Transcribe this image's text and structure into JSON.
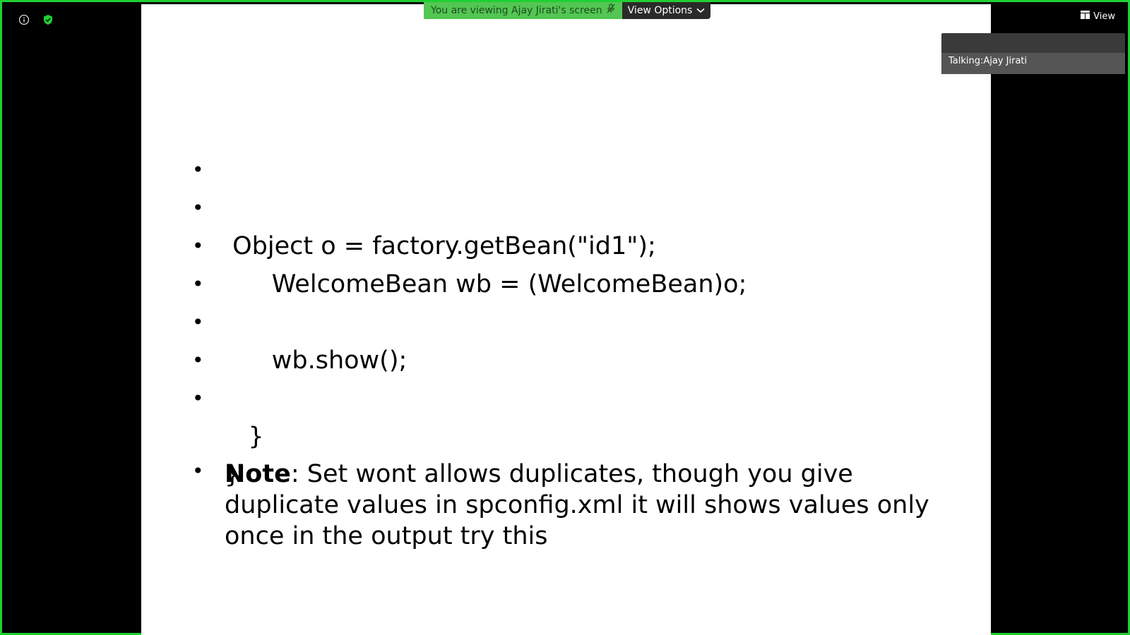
{
  "banner": {
    "info_text": "You are viewing Ajay Jirati's screen",
    "view_options_label": "View Options"
  },
  "header": {
    "view_label": "View"
  },
  "video_tile": {
    "talking_label": "Talking:Ajay Jirati"
  },
  "slide": {
    "lines": [
      " Object o = factory.getBean(\"id1\");",
      "      WelcomeBean wb = (WelcomeBean)o;",
      "",
      "      wb.show();",
      "",
      "   }",
      "}"
    ],
    "note_label": "Note",
    "note_text": ":  Set wont allows duplicates, though you give duplicate values in spconfig.xml it will shows values only once in the output try this"
  },
  "colors": {
    "border": "#1fd032",
    "banner": "#53c653",
    "slide_bg": "#ffffff"
  }
}
